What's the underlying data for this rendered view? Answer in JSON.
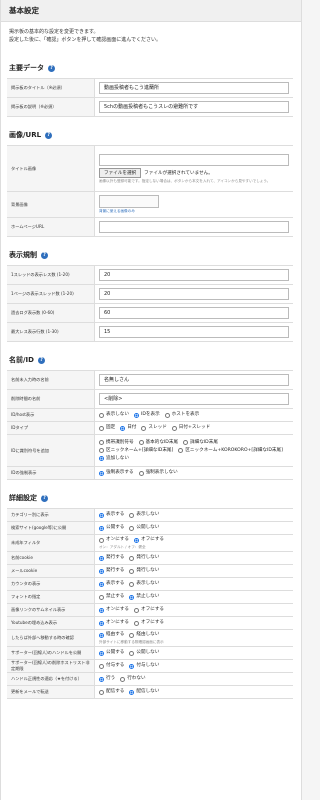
{
  "page": {
    "title": "基本設定"
  },
  "intro": [
    "掲示板の基本的な設定を変更できます。",
    "設定した後に、「確認」ボタンを押して確認画面に進んでください。"
  ],
  "main_data": {
    "title": "主要データ",
    "fields": [
      {
        "label": "掲示板のタイトル（※必須）",
        "value": "動画投稿者もこう進蘭所"
      },
      {
        "label": "掲示板の説明（※必須）",
        "value": "5chの動画投稿者もこうスレの避難所です"
      }
    ]
  },
  "image_url": {
    "title": "画像/URL",
    "title_image": {
      "label": "タイトル画像",
      "file_button": "ファイルを選択",
      "file_status": "ファイルが選択されていません。",
      "note": "画像以外も登録可能です。指定しない場合は、ボタンから本文を入れて、アイコンから見やすいでしょう。"
    },
    "bg_image": {
      "label": "背景画像",
      "note": "背景に使える画像のみ"
    },
    "homepage": {
      "label": "ホームページURL",
      "value": ""
    }
  },
  "display": {
    "title": "表示規制",
    "fields": [
      {
        "label": "1スレッドの表示レス数 (1-20)",
        "value": "20"
      },
      {
        "label": "1ページの表示スレッド数 (1-20)",
        "value": "20"
      },
      {
        "label": "過去ログ表示数 (0-60)",
        "value": "60"
      },
      {
        "label": "最大レス表示行数 (1-30)",
        "value": "15"
      }
    ]
  },
  "name_id": {
    "title": "名前/ID",
    "default_name": {
      "label": "名前未入力時の名前",
      "value": "名無しさん"
    },
    "delete_name": {
      "label": "削除時間の名前",
      "value": "<削除>"
    },
    "id_host": {
      "label": "ID/host表示",
      "options": [
        "表示しない",
        "IDを表示",
        "ホストを表示"
      ],
      "selected": 1
    },
    "id_type": {
      "label": "IDタイプ",
      "options": [
        "固定",
        "日付",
        "スレッド",
        "日付+スレッド"
      ],
      "selected": 1
    },
    "id_suffix": {
      "label": "IDに識別符号を追加",
      "options": [
        "携帯識別符号",
        "基本的なID末尾",
        "詳細なID末尾",
        "区ニックネーム+[詳細なID末尾]",
        "区ニックネーム+KOROKORO+[詳細なID末尾]",
        "追加しない"
      ],
      "selected": 5
    },
    "id_force": {
      "label": "IDの強制表示",
      "options": [
        "強制表示する",
        "強制表示しない"
      ],
      "selected": 0
    }
  },
  "details": {
    "title": "詳細設定",
    "rows": [
      {
        "label": "カテゴリー別に表示",
        "options": [
          "表示する",
          "表示しない"
        ],
        "selected": 0
      },
      {
        "label": "検索サイト(google等)に公開",
        "options": [
          "公開する",
          "公開しない"
        ],
        "selected": 0
      },
      {
        "label": "未成年フィルタ",
        "options": [
          "オンにする",
          "オフにする"
        ],
        "selected": 1,
        "note": "オン：アダルト / オフ：健全"
      },
      {
        "label": "名前cookie",
        "options": [
          "発行する",
          "発行しない"
        ],
        "selected": 0
      },
      {
        "label": "メールcookie",
        "options": [
          "発行する",
          "発行しない"
        ],
        "selected": 0
      },
      {
        "label": "カウンタの表示",
        "options": [
          "表示する",
          "表示しない"
        ],
        "selected": 0
      },
      {
        "label": "フォントの指定",
        "options": [
          "禁止する",
          "禁止しない"
        ],
        "selected": 1
      },
      {
        "label": "画像リンクのサムネイル表示",
        "options": [
          "オンにする",
          "オフにする"
        ],
        "selected": 0
      },
      {
        "label": "Youtubeの埋め込み表示",
        "options": [
          "オンにする",
          "オフにする"
        ],
        "selected": 0
      },
      {
        "label": "したらば外部へ移動する時の確認",
        "options": [
          "経由する",
          "経由しない"
        ],
        "selected": 0,
        "note": "外部サイトに移動する際確認画面に表示"
      },
      {
        "label": "サポーター(回線人)のハンドルを公開",
        "options": [
          "公開する",
          "公開しない"
        ],
        "selected": 0
      },
      {
        "label": "サポーター(回線人)の削除ホストリスト非定期限",
        "options": [
          "付与する",
          "付与しない"
        ],
        "selected": 1
      },
      {
        "label": "ハンドル正規性の適応（★を付ける）",
        "options": [
          "行う",
          "行わない"
        ],
        "selected": 0
      },
      {
        "label": "更新をメールで転送",
        "options": [
          "配信する",
          "配信しない"
        ],
        "selected": 1
      }
    ]
  }
}
